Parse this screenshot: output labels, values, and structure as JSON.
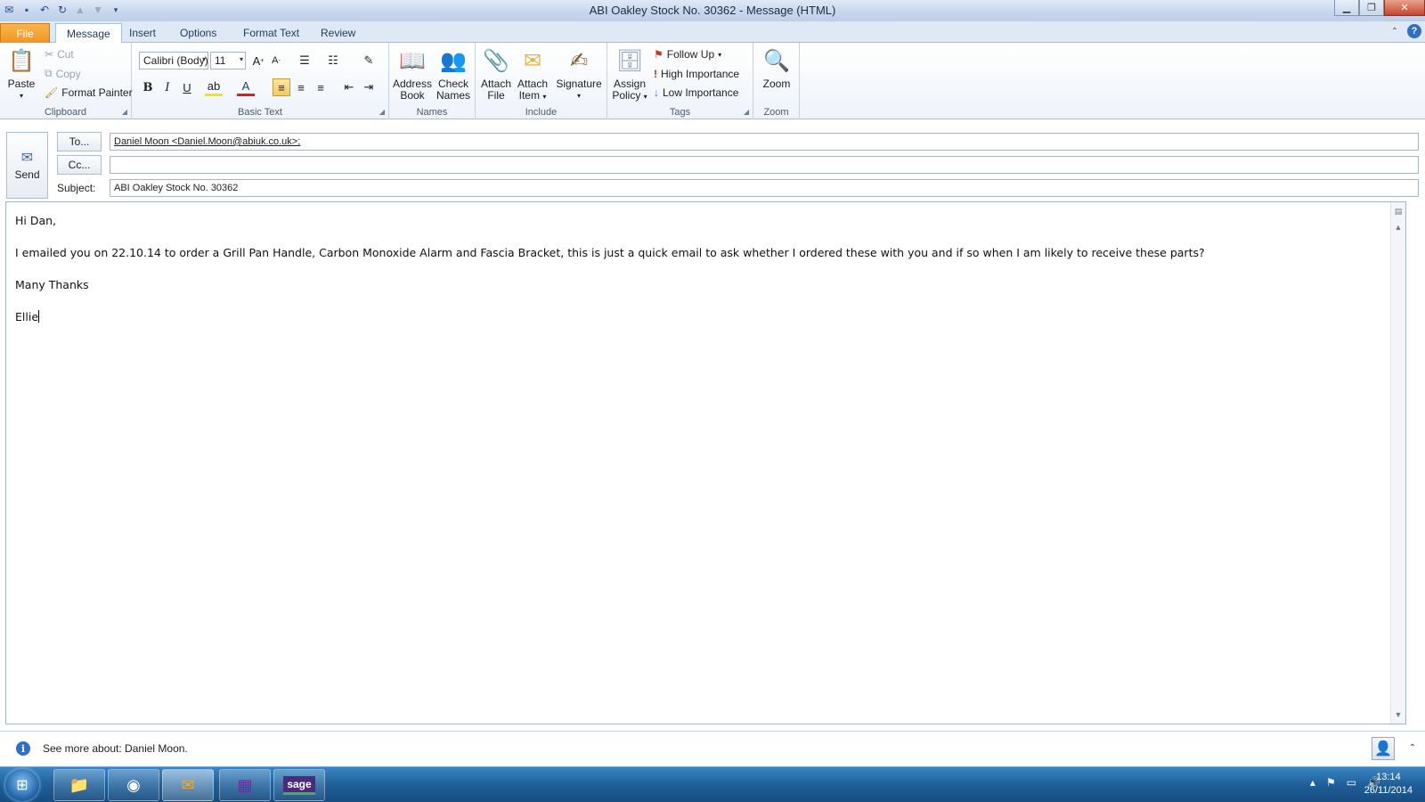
{
  "window": {
    "title": "ABI Oakley Stock No. 30362  -  Message (HTML)"
  },
  "tabs": {
    "file": "File",
    "message": "Message",
    "insert": "Insert",
    "options": "Options",
    "format_text": "Format Text",
    "review": "Review"
  },
  "ribbon": {
    "clipboard": {
      "paste": "Paste",
      "cut": "Cut",
      "copy": "Copy",
      "format_painter": "Format Painter",
      "label": "Clipboard"
    },
    "basic_text": {
      "font_name": "Calibri (Body)",
      "font_size": "11",
      "label": "Basic Text"
    },
    "names": {
      "address_book_1": "Address",
      "address_book_2": "Book",
      "check_names_1": "Check",
      "check_names_2": "Names",
      "label": "Names"
    },
    "include": {
      "attach_file_1": "Attach",
      "attach_file_2": "File",
      "attach_item_1": "Attach",
      "attach_item_2": "Item",
      "signature": "Signature",
      "label": "Include"
    },
    "tags": {
      "assign_policy_1": "Assign",
      "assign_policy_2": "Policy",
      "follow_up": "Follow Up",
      "high_importance": "High Importance",
      "low_importance": "Low Importance",
      "label": "Tags"
    },
    "zoom": {
      "zoom_button": "Zoom",
      "label": "Zoom"
    }
  },
  "header": {
    "send": "Send",
    "to_button": "To...",
    "cc_button": "Cc...",
    "subject_label": "Subject:",
    "to_value": "Daniel Moon <Daniel.Moon@abiuk.co.uk>;",
    "cc_value": "",
    "subject_value": "ABI Oakley Stock No. 30362"
  },
  "body": {
    "greeting": "Hi Dan,",
    "paragraph": "I emailed you on 22.10.14 to order a Grill Pan Handle, Carbon Monoxide Alarm and Fascia Bracket, this is just a quick email to ask whether I ordered these with you and if so when I am likely to receive these parts?",
    "closing": "Many Thanks",
    "signature": "Ellie"
  },
  "people_pane": {
    "see_more": "See more about: Daniel Moon."
  },
  "taskbar": {
    "time": "13:14",
    "date": "26/11/2014",
    "sage_label": "sage"
  },
  "colors": {
    "file_tab": "#f29422",
    "accent_blue": "#2f6fc6",
    "taskbar": "#1f5f9a"
  }
}
